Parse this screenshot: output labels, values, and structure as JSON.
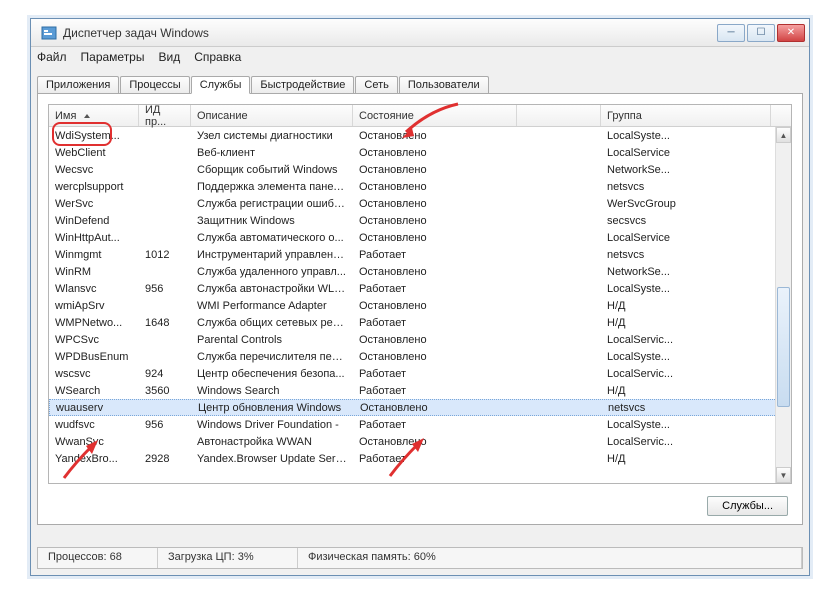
{
  "window": {
    "title": "Диспетчер задач Windows"
  },
  "menu": {
    "file": "Файл",
    "params": "Параметры",
    "view": "Вид",
    "help": "Справка"
  },
  "tabs": {
    "apps": "Приложения",
    "processes": "Процессы",
    "services": "Службы",
    "perf": "Быстродействие",
    "net": "Сеть",
    "users": "Пользователи"
  },
  "columns": {
    "name": "Имя",
    "pid": "ИД пр...",
    "desc": "Описание",
    "state": "Состояние",
    "group": "Группа"
  },
  "rows": [
    {
      "name": "WdiSystem...",
      "pid": "",
      "desc": "Узел системы диагностики",
      "state": "Остановлено",
      "group": "LocalSyste..."
    },
    {
      "name": "WebClient",
      "pid": "",
      "desc": "Веб-клиент",
      "state": "Остановлено",
      "group": "LocalService"
    },
    {
      "name": "Wecsvc",
      "pid": "",
      "desc": "Сборщик событий Windows",
      "state": "Остановлено",
      "group": "NetworkSe..."
    },
    {
      "name": "wercplsupport",
      "pid": "",
      "desc": "Поддержка элемента панел...",
      "state": "Остановлено",
      "group": "netsvcs"
    },
    {
      "name": "WerSvc",
      "pid": "",
      "desc": "Служба регистрации ошибо...",
      "state": "Остановлено",
      "group": "WerSvcGroup"
    },
    {
      "name": "WinDefend",
      "pid": "",
      "desc": "Защитник Windows",
      "state": "Остановлено",
      "group": "secsvcs"
    },
    {
      "name": "WinHttpAut...",
      "pid": "",
      "desc": "Служба автоматического о...",
      "state": "Остановлено",
      "group": "LocalService"
    },
    {
      "name": "Winmgmt",
      "pid": "1012",
      "desc": "Инструментарий управлени...",
      "state": "Работает",
      "group": "netsvcs"
    },
    {
      "name": "WinRM",
      "pid": "",
      "desc": "Служба удаленного управл...",
      "state": "Остановлено",
      "group": "NetworkSe..."
    },
    {
      "name": "Wlansvc",
      "pid": "956",
      "desc": "Служба автонастройки WLAN",
      "state": "Работает",
      "group": "LocalSyste..."
    },
    {
      "name": "wmiApSrv",
      "pid": "",
      "desc": "WMI Performance Adapter",
      "state": "Остановлено",
      "group": "Н/Д"
    },
    {
      "name": "WMPNetwo...",
      "pid": "1648",
      "desc": "Служба общих сетевых рес...",
      "state": "Работает",
      "group": "Н/Д"
    },
    {
      "name": "WPCSvc",
      "pid": "",
      "desc": "Parental Controls",
      "state": "Остановлено",
      "group": "LocalServic..."
    },
    {
      "name": "WPDBusEnum",
      "pid": "",
      "desc": "Служба перечислителя пер...",
      "state": "Остановлено",
      "group": "LocalSyste..."
    },
    {
      "name": "wscsvc",
      "pid": "924",
      "desc": "Центр обеспечения безопа...",
      "state": "Работает",
      "group": "LocalServic..."
    },
    {
      "name": "WSearch",
      "pid": "3560",
      "desc": "Windows Search",
      "state": "Работает",
      "group": "Н/Д"
    },
    {
      "name": "wuauserv",
      "pid": "",
      "desc": "Центр обновления Windows",
      "state": "Остановлено",
      "group": "netsvcs",
      "selected": true
    },
    {
      "name": "wudfsvc",
      "pid": "956",
      "desc": "Windows Driver Foundation -",
      "state": "Работает",
      "group": "LocalSyste..."
    },
    {
      "name": "WwanSvc",
      "pid": "",
      "desc": "Автонастройка WWAN",
      "state": "Остановлено",
      "group": "LocalServic..."
    },
    {
      "name": "YandexBro...",
      "pid": "2928",
      "desc": "Yandex.Browser Update Serv...",
      "state": "Работает",
      "group": "Н/Д"
    }
  ],
  "buttons": {
    "services": "Службы..."
  },
  "status": {
    "procs": "Процессов: 68",
    "cpu": "Загрузка ЦП: 3%",
    "mem": "Физическая память: 60%"
  }
}
